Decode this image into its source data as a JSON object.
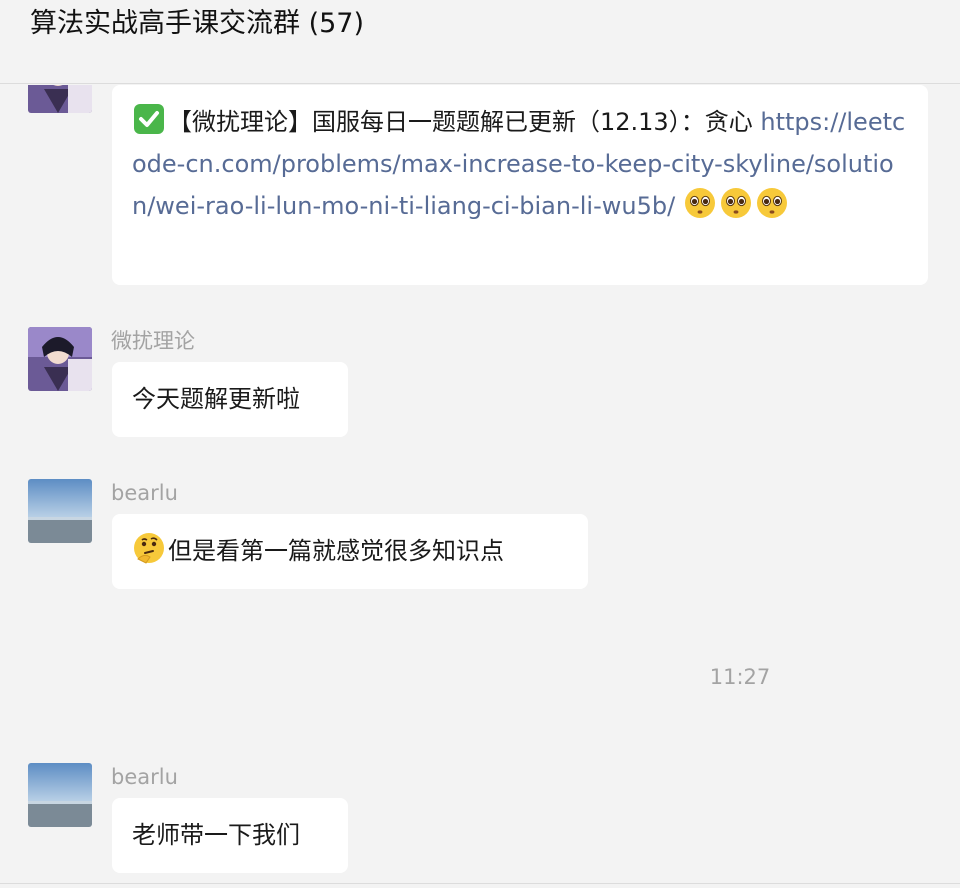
{
  "header": {
    "title": "算法实战高手课交流群 (57)"
  },
  "messages": [
    {
      "text_prefix": "【微扰理论】国服每日一题题解已更新（12.13）：贪心",
      "link": "https://leetcode-cn.com/problems/max-increase-to-keep-city-skyline/solution/wei-rao-li-lun-mo-ni-ti-liang-ci-bian-li-wu5b/",
      "leading_icon": "check-mark-emoji",
      "trailing_icons": [
        "pleading-face-emoji",
        "pleading-face-emoji",
        "pleading-face-emoji"
      ]
    },
    {
      "sender": "微扰理论",
      "text": "今天题解更新啦"
    },
    {
      "sender": "bearlu",
      "text": "但是看第一篇就感觉很多知识点",
      "leading_icon": "thinking-face-emoji"
    },
    {
      "sender": "bearlu",
      "text": "老师带一下我们"
    }
  ],
  "timestamp": "11:27",
  "colors": {
    "background": "#f3f3f3",
    "bubble": "#ffffff",
    "link": "#576b95",
    "muted": "#a3a3a3"
  }
}
